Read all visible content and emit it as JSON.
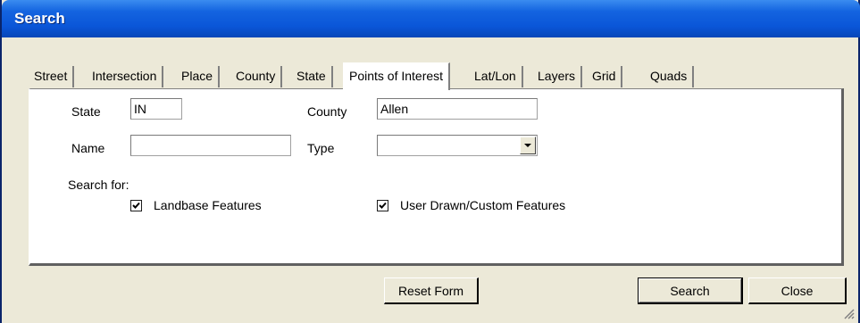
{
  "window": {
    "title": "Search"
  },
  "tabs": [
    {
      "label": "Street"
    },
    {
      "label": "Intersection"
    },
    {
      "label": "Place"
    },
    {
      "label": "County"
    },
    {
      "label": "State"
    },
    {
      "label": "Points of Interest",
      "selected": true
    },
    {
      "label": "Lat/Lon"
    },
    {
      "label": "Layers"
    },
    {
      "label": "Grid"
    },
    {
      "label": "Quads"
    }
  ],
  "form": {
    "state_label": "State",
    "state_value": "IN",
    "county_label": "County",
    "county_value": "Allen",
    "name_label": "Name",
    "name_value": "",
    "type_label": "Type",
    "type_value": "",
    "search_for_label": "Search for:",
    "landbase_label": "Landbase Features",
    "landbase_checked": true,
    "user_drawn_label": "User Drawn/Custom Features",
    "user_drawn_checked": true
  },
  "buttons": {
    "reset": "Reset Form",
    "search": "Search",
    "close": "Close"
  },
  "colors": {
    "titlebar": "#0a56d8",
    "dialog_bg": "#ece9d8",
    "panel_bg": "#ffffff"
  }
}
